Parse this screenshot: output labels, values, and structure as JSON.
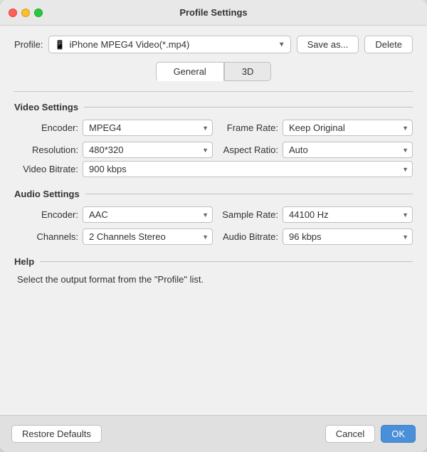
{
  "window": {
    "title": "Profile Settings"
  },
  "profile": {
    "label": "Profile:",
    "value": "iPhone MPEG4 Video(*.mp4)",
    "icon": "📱"
  },
  "buttons": {
    "save_as": "Save as...",
    "delete": "Delete",
    "restore_defaults": "Restore Defaults",
    "cancel": "Cancel",
    "ok": "OK"
  },
  "tabs": [
    {
      "label": "General",
      "active": true
    },
    {
      "label": "3D",
      "active": false
    }
  ],
  "video_settings": {
    "section_title": "Video Settings",
    "encoder_label": "Encoder:",
    "encoder_value": "MPEG4",
    "frame_rate_label": "Frame Rate:",
    "frame_rate_value": "Keep Original",
    "resolution_label": "Resolution:",
    "resolution_value": "480*320",
    "aspect_ratio_label": "Aspect Ratio:",
    "aspect_ratio_value": "Auto",
    "video_bitrate_label": "Video Bitrate:",
    "video_bitrate_value": "900 kbps"
  },
  "audio_settings": {
    "section_title": "Audio Settings",
    "encoder_label": "Encoder:",
    "encoder_value": "AAC",
    "sample_rate_label": "Sample Rate:",
    "sample_rate_value": "44100 Hz",
    "channels_label": "Channels:",
    "channels_value": "2 Channels Stereo",
    "audio_bitrate_label": "Audio Bitrate:",
    "audio_bitrate_value": "96 kbps"
  },
  "help": {
    "section_title": "Help",
    "text": "Select the output format from the \"Profile\" list."
  }
}
